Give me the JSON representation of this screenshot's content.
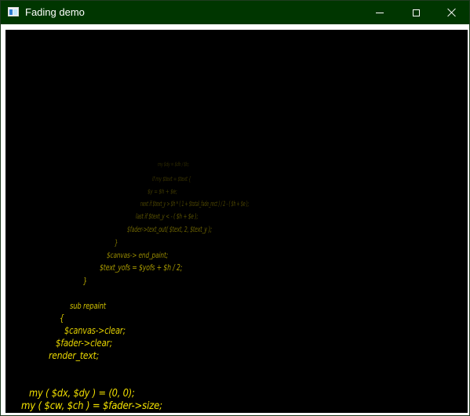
{
  "window": {
    "title": "Fading demo"
  },
  "titlebar": {
    "app_icon": "window-app-icon",
    "minimize_icon": "minimize-icon",
    "maximize_icon": "maximize-icon",
    "close_icon": "close-icon"
  },
  "canvas": {
    "background": "#000000",
    "text_color": "#f0e200",
    "lines": [
      "my $dy = $dh / $h;",
      "if my $text = $text {",
      "$y = $h + $e;",
      "next if $text_y > $h * ( 1 + $total_fade_rect ) / 2 - ( $h + $e );",
      "last if $text_y < - ( $h + $e );",
      "$fader->text_out( $text, 2, $text_y );",
      "}",
      "$canvas-> end_paint;",
      "$text_yofs = $yofs + $h / 2;",
      "}",
      "sub repaint",
      "{",
      "$canvas->clear;",
      "$fader->clear;",
      "render_text;",
      "my ( $dx, $dy ) = (0, 0);",
      "my ( $cw, $ch ) = $fader->size;"
    ]
  }
}
